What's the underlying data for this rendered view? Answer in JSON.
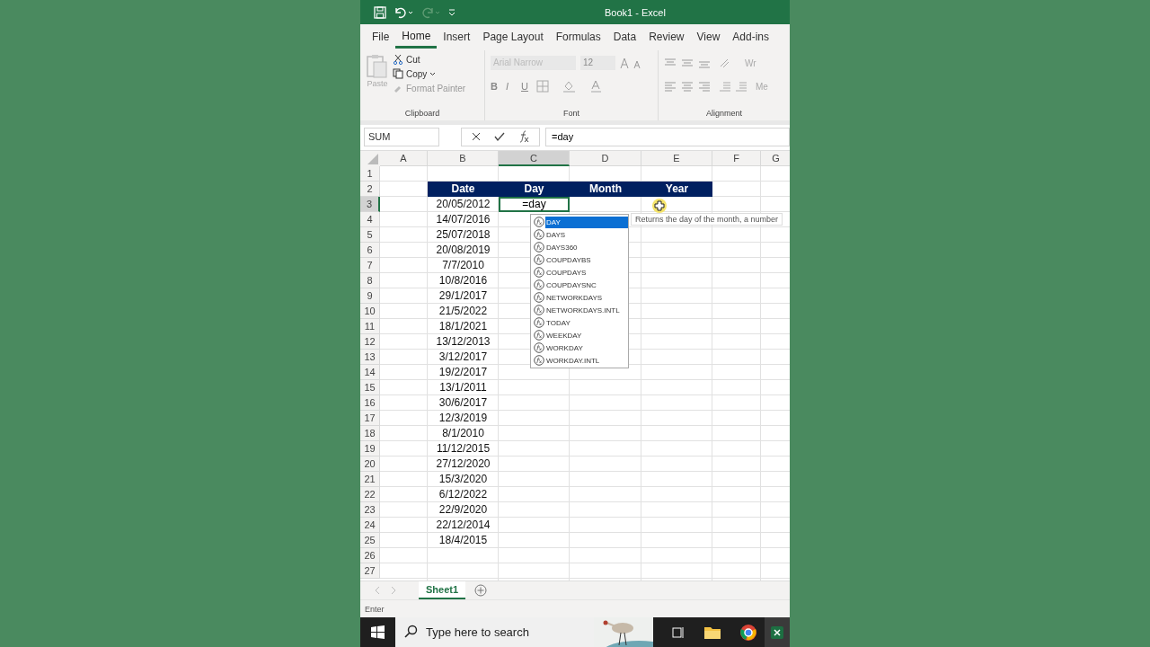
{
  "window": {
    "title": "Book1  -  Excel"
  },
  "ribbon_tabs": [
    {
      "label": "File",
      "selected": false
    },
    {
      "label": "Home",
      "selected": true
    },
    {
      "label": "Insert",
      "selected": false
    },
    {
      "label": "Page Layout",
      "selected": false
    },
    {
      "label": "Formulas",
      "selected": false
    },
    {
      "label": "Data",
      "selected": false
    },
    {
      "label": "Review",
      "selected": false
    },
    {
      "label": "View",
      "selected": false
    },
    {
      "label": "Add-ins",
      "selected": false
    }
  ],
  "clipboard": {
    "paste": "Paste",
    "cut": "Cut",
    "copy": "Copy",
    "format_painter": "Format Painter",
    "label": "Clipboard"
  },
  "font": {
    "name": "Arial Narrow",
    "size": "12",
    "bold": "B",
    "italic": "I",
    "underline": "U",
    "label": "Font"
  },
  "alignment": {
    "wrap": "Wr",
    "merge": "Me",
    "label": "Alignment"
  },
  "formula_bar": {
    "name_box": "SUM",
    "value": "=day"
  },
  "columns": [
    {
      "label": "A",
      "selected": false
    },
    {
      "label": "B",
      "selected": false
    },
    {
      "label": "C",
      "selected": true
    },
    {
      "label": "D",
      "selected": false
    },
    {
      "label": "E",
      "selected": false
    },
    {
      "label": "F",
      "selected": false
    },
    {
      "label": "G",
      "selected": false
    }
  ],
  "row_numbers": [
    {
      "label": "1",
      "selected": false
    },
    {
      "label": "2",
      "selected": false
    },
    {
      "label": "3",
      "selected": true
    },
    {
      "label": "4",
      "selected": false
    },
    {
      "label": "5",
      "selected": false
    },
    {
      "label": "6",
      "selected": false
    },
    {
      "label": "7",
      "selected": false
    },
    {
      "label": "8",
      "selected": false
    },
    {
      "label": "9",
      "selected": false
    },
    {
      "label": "10",
      "selected": false
    },
    {
      "label": "11",
      "selected": false
    },
    {
      "label": "12",
      "selected": false
    },
    {
      "label": "13",
      "selected": false
    },
    {
      "label": "14",
      "selected": false
    },
    {
      "label": "15",
      "selected": false
    },
    {
      "label": "16",
      "selected": false
    },
    {
      "label": "17",
      "selected": false
    },
    {
      "label": "18",
      "selected": false
    },
    {
      "label": "19",
      "selected": false
    },
    {
      "label": "20",
      "selected": false
    },
    {
      "label": "21",
      "selected": false
    },
    {
      "label": "22",
      "selected": false
    },
    {
      "label": "23",
      "selected": false
    },
    {
      "label": "24",
      "selected": false
    },
    {
      "label": "25",
      "selected": false
    },
    {
      "label": "26",
      "selected": false
    },
    {
      "label": "27",
      "selected": false
    }
  ],
  "table_header": [
    "Date",
    "Day",
    "Month",
    "Year"
  ],
  "dates": [
    "20/05/2012",
    "14/07/2016",
    "25/07/2018",
    "20/08/2019",
    "7/7/2010",
    "10/8/2016",
    "29/1/2017",
    "21/5/2022",
    "18/1/2021",
    "13/12/2013",
    "3/12/2017",
    "19/2/2017",
    "13/1/2011",
    "30/6/2017",
    "12/3/2019",
    "8/1/2010",
    "11/12/2015",
    "27/12/2020",
    "15/3/2020",
    "6/12/2022",
    "22/9/2020",
    "22/12/2014",
    "18/4/2015"
  ],
  "editing_cell": "=day",
  "autocomplete": [
    {
      "label": "DAY",
      "selected": true
    },
    {
      "label": "DAYS",
      "selected": false
    },
    {
      "label": "DAYS360",
      "selected": false
    },
    {
      "label": "COUPDAYBS",
      "selected": false
    },
    {
      "label": "COUPDAYS",
      "selected": false
    },
    {
      "label": "COUPDAYSNC",
      "selected": false
    },
    {
      "label": "NETWORKDAYS",
      "selected": false
    },
    {
      "label": "NETWORKDAYS.INTL",
      "selected": false
    },
    {
      "label": "TODAY",
      "selected": false
    },
    {
      "label": "WEEKDAY",
      "selected": false
    },
    {
      "label": "WORKDAY",
      "selected": false
    },
    {
      "label": "WORKDAY.INTL",
      "selected": false
    }
  ],
  "tooltip": "Returns the day of the month, a number",
  "sheet_tabs": [
    {
      "label": "Sheet1",
      "selected": true
    }
  ],
  "status_bar": "Enter",
  "taskbar": {
    "search": {
      "placeholder": "Type here to search"
    }
  }
}
